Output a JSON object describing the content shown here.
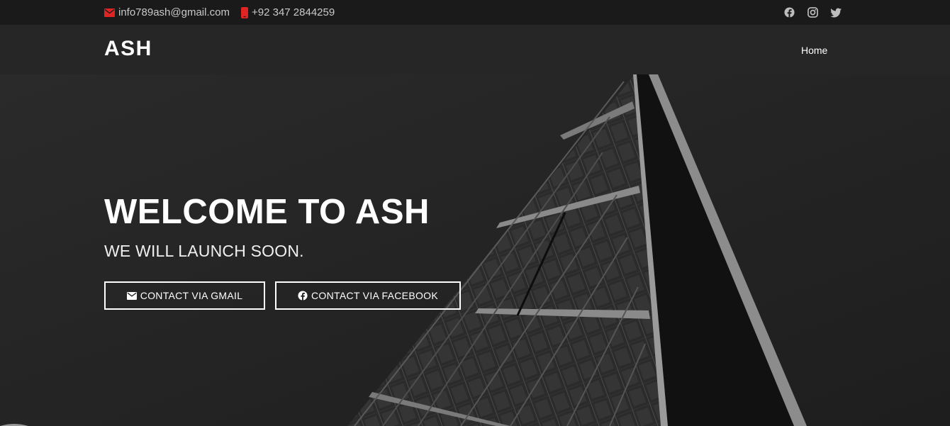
{
  "topbar": {
    "email": "info789ash@gmail.com",
    "phone": "+92 347 2844259",
    "social": [
      "facebook-icon",
      "instagram-icon",
      "twitter-icon"
    ],
    "accent_color": "#e02424"
  },
  "nav": {
    "brand": "ASH",
    "home_label": "Home"
  },
  "hero": {
    "title": "WELCOME TO ASH",
    "subtitle": "WE WILL LAUNCH SOON.",
    "buttons": {
      "gmail": "CONTACT VIA GMAIL",
      "facebook": "CONTACT VIA FACEBOOK"
    }
  }
}
